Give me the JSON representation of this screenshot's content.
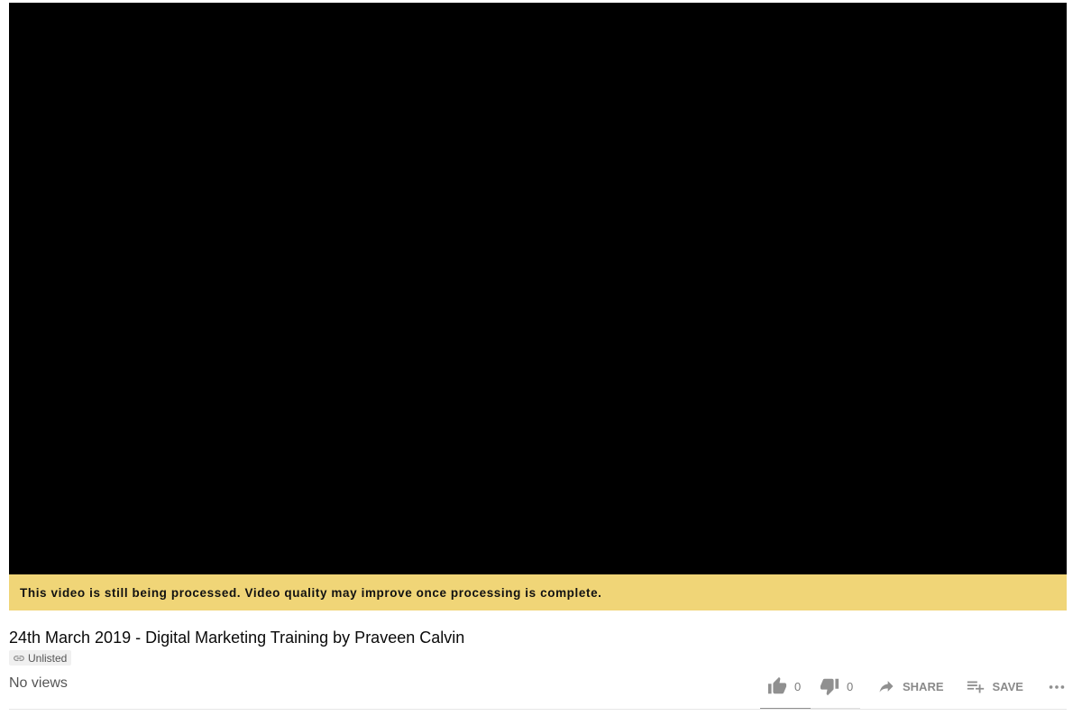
{
  "video": {
    "processing_notice": "This video is still being processed. Video quality may improve once processing is complete.",
    "title": "24th March 2019 - Digital Marketing Training by Praveen Calvin",
    "privacy_badge": "Unlisted",
    "views": "No views"
  },
  "actions": {
    "like_count": "0",
    "dislike_count": "0",
    "share_label": "SHARE",
    "save_label": "SAVE",
    "like_ratio": 0.5
  },
  "colors": {
    "notice_bg": "#f0d577",
    "player_bg": "#000000",
    "icon_gray": "#909090"
  },
  "icons": {
    "like": "thumb-up-icon",
    "dislike": "thumb-down-icon",
    "share": "share-arrow-icon",
    "save": "playlist-add-icon",
    "more": "more-horiz-icon",
    "badge": "link-icon"
  }
}
